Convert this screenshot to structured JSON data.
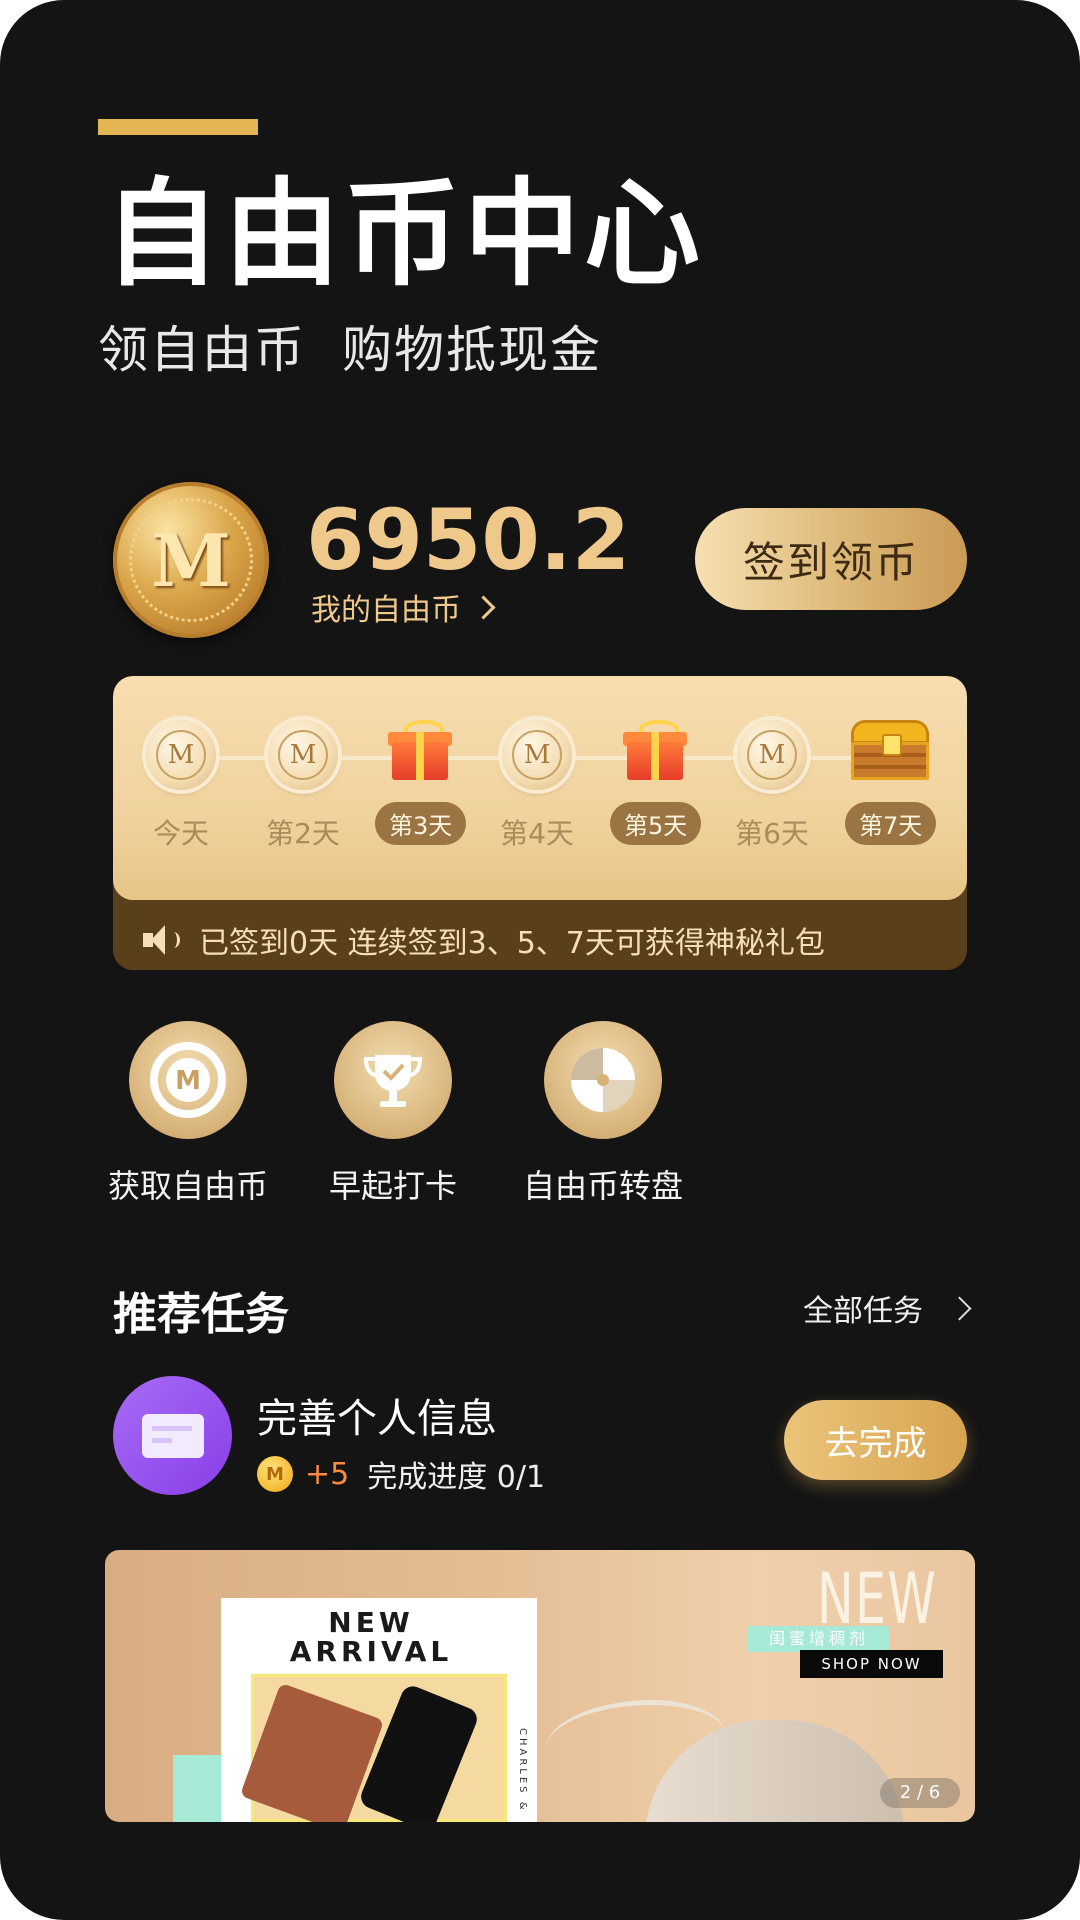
{
  "header": {
    "title": "自由币中心",
    "subtitle_1": "领自由币",
    "subtitle_2": "购物抵现金"
  },
  "balance": {
    "coin_letter": "M",
    "amount": "6950.2",
    "label": "我的自由币"
  },
  "signin_button": "签到领币",
  "checkin": {
    "days": [
      {
        "label": "今天",
        "reward": "coin",
        "coin_letter": "M",
        "highlight": false
      },
      {
        "label": "第2天",
        "reward": "coin",
        "coin_letter": "M",
        "highlight": false
      },
      {
        "label": "第3天",
        "reward": "gift",
        "highlight": true
      },
      {
        "label": "第4天",
        "reward": "coin",
        "coin_letter": "M",
        "highlight": false
      },
      {
        "label": "第5天",
        "reward": "gift",
        "highlight": true
      },
      {
        "label": "第6天",
        "reward": "coin",
        "coin_letter": "M",
        "highlight": false
      },
      {
        "label": "第7天",
        "reward": "treasure-chest",
        "highlight": true
      }
    ],
    "notice": "已签到0天 连续签到3、5、7天可获得神秘礼包",
    "notice_icon": "speaker-icon"
  },
  "features": [
    {
      "label": "获取自由币",
      "icon": "m-coin-icon",
      "icon_letter": "M"
    },
    {
      "label": "早起打卡",
      "icon": "trophy-icon"
    },
    {
      "label": "自由币转盘",
      "icon": "spin-wheel-icon"
    }
  ],
  "tasks_section": {
    "title": "推荐任务",
    "all_tasks_link": "全部任务"
  },
  "task": {
    "name": "完善个人信息",
    "icon": "id-card-icon",
    "coin_letter": "M",
    "reward": "+5",
    "progress": "完成进度 0/1",
    "button": "去完成"
  },
  "banner": {
    "card_title_line1": "NEW",
    "card_title_line2": "ARRIVAL",
    "card_side_text": "CHARLES &",
    "big_text": "NEW",
    "tag": "闺蜜增稠剂",
    "shop_now": "SHOP NOW",
    "pager": "2 / 6"
  },
  "colors": {
    "background": "#141414",
    "accent": "#E4B553",
    "balance_text": "#EFC98C",
    "reward_orange": "#FF8A3D"
  }
}
